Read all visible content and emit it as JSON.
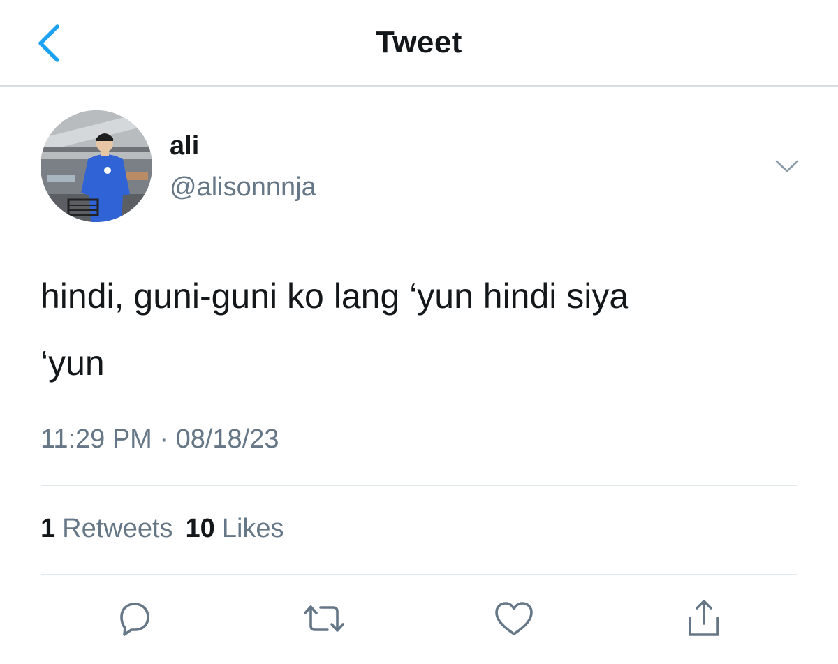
{
  "header": {
    "title": "Tweet"
  },
  "author": {
    "name": "ali",
    "handle": "@alisonnnja"
  },
  "tweet": {
    "line1": "hindi, guni-guni ko lang ‘yun hindi siya",
    "line2": "‘yun"
  },
  "meta": {
    "timestamp": "11:29 PM · 08/18/23"
  },
  "stats": {
    "retweets_count": "1",
    "retweets_label": "Retweets",
    "likes_count": "10",
    "likes_label": "Likes"
  },
  "icons": {
    "back": "chevron-left-icon",
    "more": "chevron-down-icon",
    "reply": "reply-icon",
    "retweet": "retweet-icon",
    "like": "heart-icon",
    "share": "share-icon"
  },
  "colors": {
    "accent": "#1da1f2",
    "muted": "#657786",
    "text": "#14171a"
  }
}
